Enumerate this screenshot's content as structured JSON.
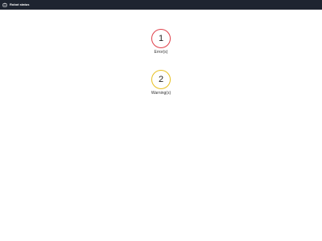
{
  "header": {
    "title": "Robot status",
    "icon": "robot-icon",
    "background": "#1e2430"
  },
  "status": {
    "errors": {
      "count": "1",
      "label": "Error(s)",
      "color": "#e0404a"
    },
    "warnings": {
      "count": "2",
      "label": "Warning(s)",
      "color": "#e8c020"
    }
  }
}
